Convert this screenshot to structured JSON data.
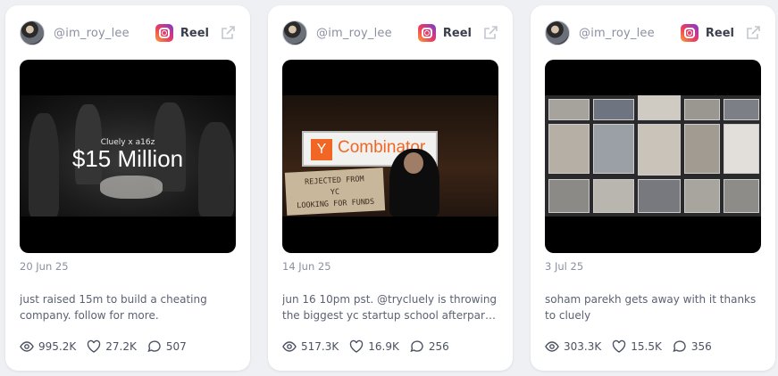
{
  "colors": {
    "page_background": "#eef0f4",
    "card_background": "#ffffff",
    "muted_text": "#8a90a0",
    "body_text": "#5c6272",
    "instagram_gradient": [
      "#f9a23b",
      "#ec3c5e",
      "#b53a9e",
      "#6a3ccf"
    ]
  },
  "cards": [
    {
      "handle": "@im_roy_lee",
      "platform_icon": "instagram-icon",
      "platform_label": "Reel",
      "open_icon": "external-link-icon",
      "media_overlay_small": "Cluely x a16z",
      "media_overlay_big": "$15 Million",
      "date": "20 Jun 25",
      "caption_lines": [
        "just raised 15m to build a cheating",
        "company. follow for more."
      ],
      "stats": {
        "views": "995.2K",
        "likes": "27.2K",
        "comments": "507"
      }
    },
    {
      "handle": "@im_roy_lee",
      "platform_icon": "instagram-icon",
      "platform_label": "Reel",
      "open_icon": "external-link-icon",
      "media_sign": "Combinator",
      "media_sign_logo": "Y",
      "media_cardboard_lines": [
        "REJECTED FROM",
        "YC",
        "LOOKING FOR FUNDS"
      ],
      "date": "14 Jun 25",
      "caption_lines": [
        "jun 16 10pm pst. @trycluely is throwing",
        "the biggest yc startup school afterparty...."
      ],
      "stats": {
        "views": "517.3K",
        "likes": "16.9K",
        "comments": "256"
      }
    },
    {
      "handle": "@im_roy_lee",
      "platform_icon": "instagram-icon",
      "platform_label": "Reel",
      "open_icon": "external-link-icon",
      "date": "3 Jul 25",
      "caption_lines": [
        "soham parekh gets away with it thanks",
        "to cluely"
      ],
      "stats": {
        "views": "303.3K",
        "likes": "15.5K",
        "comments": "356"
      }
    }
  ]
}
